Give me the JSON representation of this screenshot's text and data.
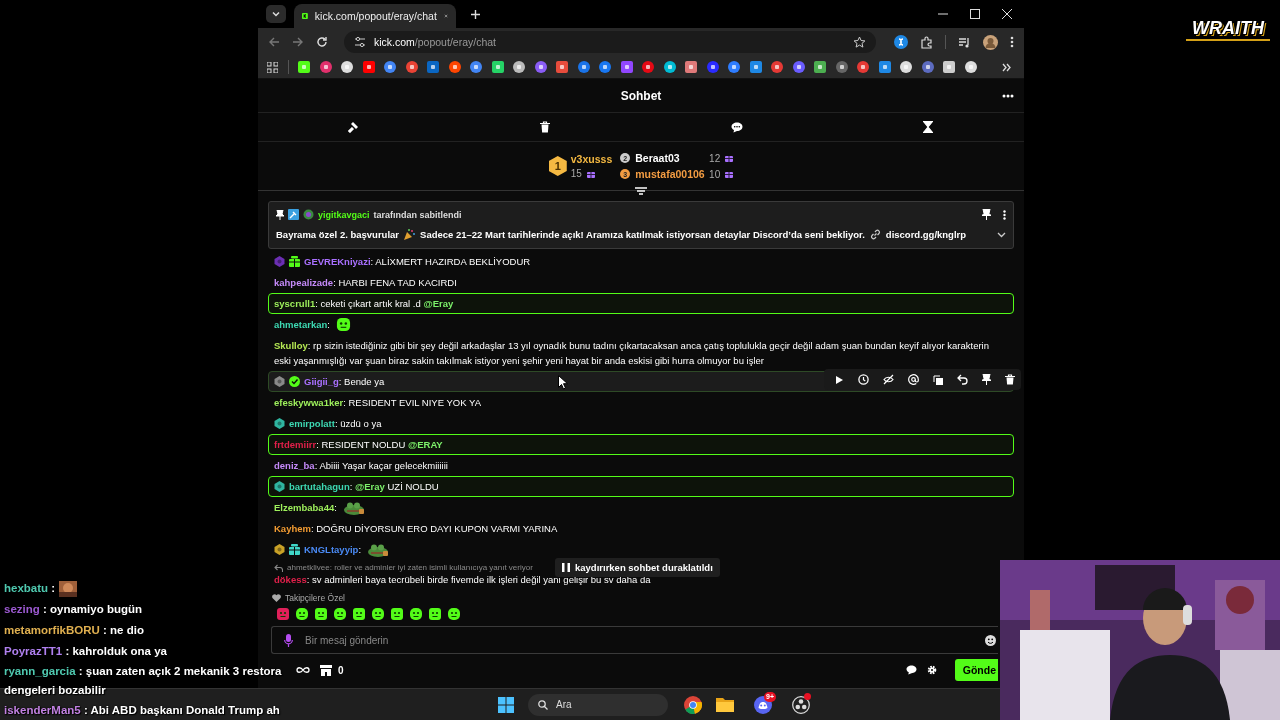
{
  "logo": "WRAITH",
  "browser": {
    "tab_title": "kick.com/popout/eray/chat",
    "url_host": "kick.com",
    "url_path": "/popout/eray/chat"
  },
  "chat": {
    "title": "Sohbet",
    "leaderboard": [
      {
        "rank": "1",
        "user": "v3xusss",
        "count": "15",
        "color": "#f5b942"
      },
      {
        "rank": "2",
        "user": "Beraat03",
        "count": "12",
        "color": "#ffffff"
      },
      {
        "rank": "3",
        "user": "mustafa00106",
        "count": "10",
        "color": "#f39c42"
      }
    ],
    "pinned": {
      "pinned_by": "yigitkavgaci",
      "pinned_label": "tarafından sabitlendi",
      "text_before": "Bayrama özel 2. başvurular",
      "text_after": "Sadece 21–22 Mart tarihlerinde açık! Aramıza katılmak istiyorsan detaylar Discord’da seni bekliyor.",
      "link": "discord.gg/knglrp"
    },
    "messages": [
      {
        "user": "GEVREKniyazi",
        "color": "#a970ff",
        "badges": [
          {
            "kind": "sub",
            "color": "#6b2fb3"
          },
          {
            "kind": "gift",
            "color": "#53fc18"
          }
        ],
        "highlighted": false,
        "hovered": false,
        "parts": [
          {
            "kind": "text",
            "text": ": ALİXMERT HAZIRDA BEKLİYODUR"
          }
        ]
      },
      {
        "user": "kahpealizade",
        "color": "#c58af9",
        "highlighted": false,
        "hovered": false,
        "parts": [
          {
            "kind": "text",
            "text": ": HARBI FENA TAD KACIRDI"
          }
        ]
      },
      {
        "user": "syscrull1",
        "color": "#9ef05c",
        "highlighted": true,
        "hovered": false,
        "parts": [
          {
            "kind": "text",
            "text": ": ceketi çıkart artık kral .d "
          },
          {
            "kind": "mention",
            "text": "@Eray"
          }
        ]
      },
      {
        "user": "ahmetarkan",
        "color": "#3dd9b3",
        "highlighted": false,
        "hovered": false,
        "parts": [
          {
            "kind": "text",
            "text": ":"
          }
        ],
        "emote": {
          "kind": "blob"
        }
      },
      {
        "user": "Skulloy",
        "color": "#b5e853",
        "highlighted": false,
        "hovered": false,
        "parts": [
          {
            "kind": "text",
            "text": ": rp sizin istediğiniz gibi bir şey değil arkadaşlar 13 yıl oynadık bunu tadını çıkartacaksan anca çatış toplulukla geçir değil adam şuan bundan keyif alıyor karakterin eski yaşanmışlığı var şuan biraz sakin takılmak istiyor yeni şehir yeni hayat bir anda eskisi gibi hurra olmuyor bu işler"
          }
        ]
      },
      {
        "user": "Giigii_g",
        "color": "#a970ff",
        "badges": [
          {
            "kind": "sub",
            "color": "#8a8a8a"
          },
          {
            "kind": "verified",
            "color": "#53fc18"
          }
        ],
        "highlighted": false,
        "hovered": true,
        "parts": [
          {
            "kind": "text",
            "text": ": Bende ya"
          }
        ]
      },
      {
        "user": "efeskywwa1ker",
        "color": "#9ef05c",
        "highlighted": false,
        "hovered": false,
        "parts": [
          {
            "kind": "text",
            "text": ": RESIDENT EVIL NIYE YOK YA"
          }
        ]
      },
      {
        "user": "emirpolatt",
        "color": "#3dd9b3",
        "badges": [
          {
            "kind": "sub",
            "color": "#2fb5a0"
          }
        ],
        "highlighted": false,
        "hovered": false,
        "parts": [
          {
            "kind": "text",
            "text": ": üzdü o ya"
          }
        ]
      },
      {
        "user": "frtdemiirr",
        "color": "#e0204a",
        "highlighted": true,
        "hovered": false,
        "parts": [
          {
            "kind": "text",
            "text": ": RESIDENT NOLDU "
          },
          {
            "kind": "mention",
            "text": "@ERAY"
          }
        ]
      },
      {
        "user": "deniz_ba",
        "color": "#c58af9",
        "highlighted": false,
        "hovered": false,
        "parts": [
          {
            "kind": "text",
            "text": ": Abiiii Yaşar kaçar gelecekmiiiiii"
          }
        ]
      },
      {
        "user": "bartutahagun",
        "color": "#3dd9b3",
        "badges": [
          {
            "kind": "sub",
            "color": "#2fb5a0"
          }
        ],
        "highlighted": true,
        "hovered": false,
        "parts": [
          {
            "kind": "text",
            "text": ": "
          },
          {
            "kind": "mention",
            "text": "@Eray"
          },
          {
            "kind": "text",
            "text": " UZİ NOLDU"
          }
        ]
      },
      {
        "user": "Elzembaba44",
        "color": "#9ef05c",
        "highlighted": false,
        "hovered": false,
        "parts": [
          {
            "kind": "text",
            "text": ":"
          }
        ],
        "emote": {
          "kind": "frog"
        }
      },
      {
        "user": "Kayhem",
        "color": "#f39c32",
        "highlighted": false,
        "hovered": false,
        "parts": [
          {
            "kind": "text",
            "text": ": DOĞRU DİYORSUN ERO DAYI KUPON VARMI YARINA"
          }
        ]
      },
      {
        "user": "KNGLtayyip",
        "color": "#4a8af4",
        "badges": [
          {
            "kind": "sub",
            "color": "#c9a227"
          },
          {
            "kind": "gift",
            "color": "#3fd6c8"
          }
        ],
        "highlighted": false,
        "hovered": false,
        "parts": [
          {
            "kind": "text",
            "text": ":"
          }
        ],
        "emote": {
          "kind": "frog"
        }
      },
      {
        "user": "dökess",
        "color": "#e0204a",
        "highlighted": false,
        "hovered": false,
        "reply_to": "ahmetklivee: roller ve adminler iyi zaten isimli kullanıcıya yanıt veriyor",
        "parts": [
          {
            "kind": "text",
            "text": ": sv adminleri baya tecrübeli birde fivemde ilk işleri değil yani gelişir bu sv daha da"
          }
        ]
      }
    ],
    "paused_banner": "kaydırırken sohbet duraklatıldı",
    "followers_label": "Takipçilere Özel",
    "input": {
      "placeholder": "Bir mesaj gönderin"
    },
    "points": "0",
    "send_button": "Gönde"
  },
  "overlay_chat": [
    {
      "user": "hexbatu",
      "color": "#4fc9b0",
      "text": ":"
    },
    {
      "user": "sezing",
      "color": "#9b59d0",
      "text": ": oynamiyo bugün"
    },
    {
      "user": "metamorfikBORU",
      "color": "#e0b050",
      "text": ": ne dio"
    },
    {
      "user": "PoyrazTT1",
      "color": "#b080f0",
      "text": ": kahrolduk ona ya"
    },
    {
      "user": "ryann_garcia",
      "color": "#4fc9b0",
      "text": ": şuan zaten açık 2 mekanik 3 restora dengeleri bozabilir"
    },
    {
      "user": "iskenderMan5",
      "color": "#c080e0",
      "text": ": Abi ABD başkanı Donald Trump ah"
    }
  ],
  "taskbar": {
    "search": {
      "placeholder": "Ara"
    },
    "discord_badge": "9+"
  }
}
